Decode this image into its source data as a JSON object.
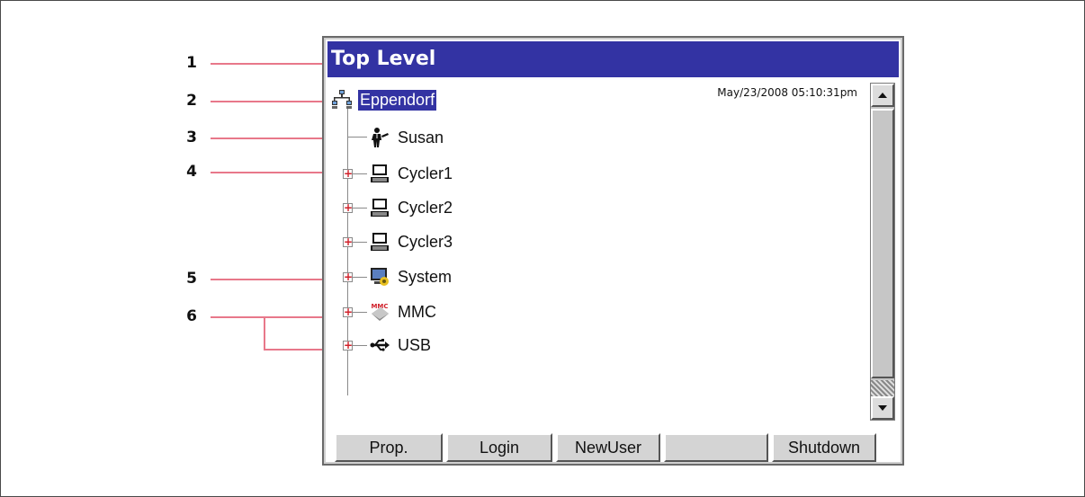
{
  "window": {
    "title": "Top Level"
  },
  "timestamp": "May/23/2008 05:10:31pm",
  "tree": {
    "root": {
      "label": "Eppendorf",
      "icon": "network-icon"
    },
    "children": [
      {
        "label": "Susan",
        "icon": "user-icon",
        "expandable": false
      },
      {
        "label": "Cycler1",
        "icon": "computer-icon",
        "expandable": true
      },
      {
        "label": "Cycler2",
        "icon": "computer-icon",
        "expandable": true
      },
      {
        "label": "Cycler3",
        "icon": "computer-icon",
        "expandable": true
      },
      {
        "label": "System",
        "icon": "system-icon",
        "expandable": true
      },
      {
        "label": "MMC",
        "icon": "mmc-card-icon",
        "expandable": true
      },
      {
        "label": "USB",
        "icon": "usb-icon",
        "expandable": true
      }
    ]
  },
  "buttons": [
    "Prop.",
    "Login",
    "NewUser",
    "",
    "Shutdown"
  ],
  "callouts": [
    "1",
    "2",
    "3",
    "4",
    "5",
    "6"
  ],
  "colors": {
    "titlebar": "#3333a3",
    "leader": "#e8788a",
    "expander_plus": "#d0202a"
  }
}
